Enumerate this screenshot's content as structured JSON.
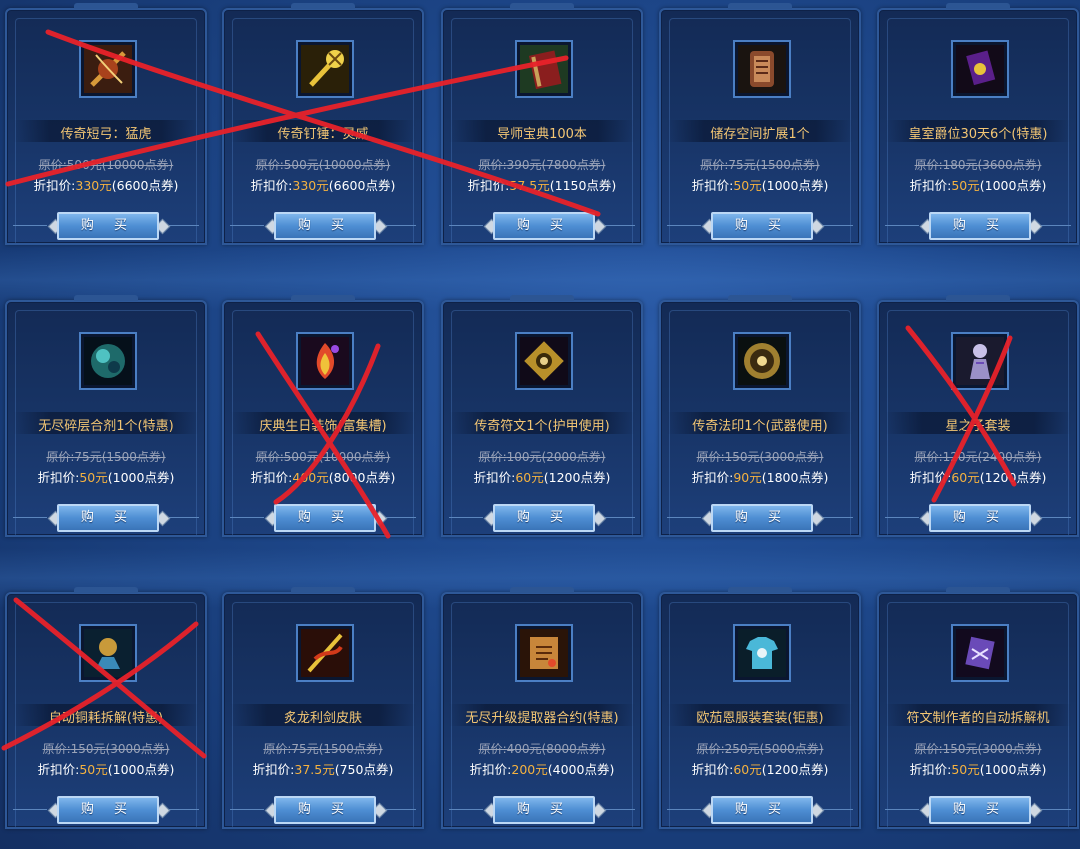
{
  "buy_label": "购 买",
  "orig_prefix": "原价:",
  "disc_prefix": "折扣价:",
  "rows": [
    [
      {
        "name": "传奇短弓：猛虎",
        "orig": "500元(10000点券)",
        "disc_price": "330元",
        "disc_points": "(6600点券)",
        "icon": "bow-icon"
      },
      {
        "name": "传奇钉锤：灵威",
        "orig": "500元(10000点券)",
        "disc_price": "330元",
        "disc_points": "(6600点券)",
        "icon": "mace-icon"
      },
      {
        "name": "导师宝典100本",
        "orig": "390元(7800点券)",
        "disc_price": "57.5元",
        "disc_points": "(1150点券)",
        "icon": "book-icon"
      },
      {
        "name": "储存空间扩展1个",
        "orig": "75元(1500点券)",
        "disc_price": "50元",
        "disc_points": "(1000点券)",
        "icon": "storage-icon"
      },
      {
        "name": "皇室爵位30天6个(特惠)",
        "orig": "180元(3600点券)",
        "disc_price": "50元",
        "disc_points": "(1000点券)",
        "icon": "royal-card-icon"
      }
    ],
    [
      {
        "name": "无尽碎层合剂1个(特惠)",
        "orig": "75元(1500点券)",
        "disc_price": "50元",
        "disc_points": "(1000点券)",
        "icon": "orb-icon"
      },
      {
        "name": "庆典生日装饰(富集槽)",
        "orig": "500元(10000点券)",
        "disc_price": "400元",
        "disc_points": "(8000点券)",
        "icon": "flame-icon"
      },
      {
        "name": "传奇符文1个(护甲使用)",
        "orig": "100元(2000点券)",
        "disc_price": "60元",
        "disc_points": "(1200点券)",
        "icon": "rune-icon"
      },
      {
        "name": "传奇法印1个(武器使用)",
        "orig": "150元(3000点券)",
        "disc_price": "90元",
        "disc_points": "(1800点券)",
        "icon": "seal-icon"
      },
      {
        "name": "星之子套装",
        "orig": "120元(2400点券)",
        "disc_price": "60元",
        "disc_points": "(1200点券)",
        "icon": "armor-set-icon"
      }
    ],
    [
      {
        "name": "自动铜耗拆解(特惠)",
        "orig": "150元(3000点券)",
        "disc_price": "50元",
        "disc_points": "(1000点券)",
        "icon": "salvage-icon"
      },
      {
        "name": "炙龙利剑皮肤",
        "orig": "75元(1500点券)",
        "disc_price": "37.5元",
        "disc_points": "(750点券)",
        "icon": "dragon-sword-icon"
      },
      {
        "name": "无尽升级提取器合约(特惠)",
        "orig": "400元(8000点券)",
        "disc_price": "200元",
        "disc_points": "(4000点券)",
        "icon": "contract-icon"
      },
      {
        "name": "欧茄恩服装套装(钜惠)",
        "orig": "250元(5000点券)",
        "disc_price": "60元",
        "disc_points": "(1200点券)",
        "icon": "tshirt-icon"
      },
      {
        "name": "符文制作者的自动拆解机",
        "orig": "150元(3000点券)",
        "disc_price": "50元",
        "disc_points": "(1000点券)",
        "icon": "rune-crafter-icon"
      }
    ]
  ],
  "colors": {
    "name_gold": "#f3c674",
    "price_orange": "#f5b240",
    "cross_red": "#e8222a",
    "background": "#1f4a8f"
  }
}
